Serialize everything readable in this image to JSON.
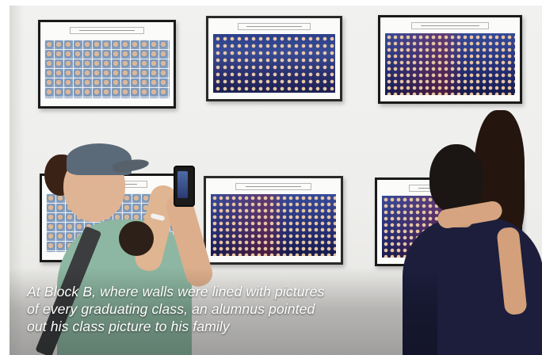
{
  "caption": {
    "line1": "At Block B, where walls were lined with pictures",
    "line2": "of every graduating class, an alumnus pointed",
    "line3": "out his class picture to his family"
  }
}
